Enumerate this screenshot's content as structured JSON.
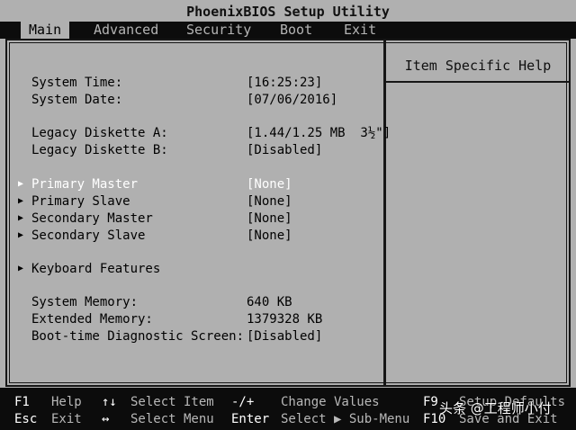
{
  "title": "PhoenixBIOS Setup Utility",
  "menu": [
    {
      "label": "Main",
      "active": true
    },
    {
      "label": "Advanced",
      "active": false
    },
    {
      "label": "Security",
      "active": false
    },
    {
      "label": "Boot",
      "active": false
    },
    {
      "label": "Exit",
      "active": false
    }
  ],
  "help": {
    "title": "Item Specific Help"
  },
  "items": {
    "system_time": {
      "label": "System Time:",
      "value": "[16:25:23]"
    },
    "system_date": {
      "label": "System Date:",
      "value": "[07/06/2016]"
    },
    "diskette_a": {
      "label": "Legacy Diskette A:",
      "value": "[1.44/1.25 MB  3½\"]"
    },
    "diskette_b": {
      "label": "Legacy Diskette B:",
      "value": "[Disabled]"
    },
    "primary_master": {
      "label": "Primary Master",
      "value": "[None]"
    },
    "primary_slave": {
      "label": "Primary Slave",
      "value": "[None]"
    },
    "secondary_master": {
      "label": "Secondary Master",
      "value": "[None]"
    },
    "secondary_slave": {
      "label": "Secondary Slave",
      "value": "[None]"
    },
    "keyboard_features": {
      "label": "Keyboard Features"
    },
    "system_memory": {
      "label": "System Memory:",
      "value": "640 KB"
    },
    "extended_memory": {
      "label": "Extended Memory:",
      "value": "1379328 KB"
    },
    "boot_diag": {
      "label": "Boot-time Diagnostic Screen:",
      "value": "[Disabled]"
    }
  },
  "footer": {
    "f1_key": "F1",
    "f1_text": "Help",
    "updown_key": "↑↓",
    "updown_text": "Select Item",
    "minusplus_key": "-/+",
    "minusplus_text": "Change Values",
    "f9_key": "F9",
    "f9_text": "Setup Defaults",
    "esc_key": "Esc",
    "esc_text": "Exit",
    "leftright_key": "↔",
    "leftright_text": "Select Menu",
    "enter_key": "Enter",
    "enter_text": "Select ▶ Sub-Menu",
    "f10_key": "F10",
    "f10_text": "Save and Exit"
  },
  "watermark": "头条 @工程师小付",
  "colors": {
    "background": "#b0b0b0",
    "bar": "#0c0c0c",
    "highlight": "#ffffff"
  }
}
